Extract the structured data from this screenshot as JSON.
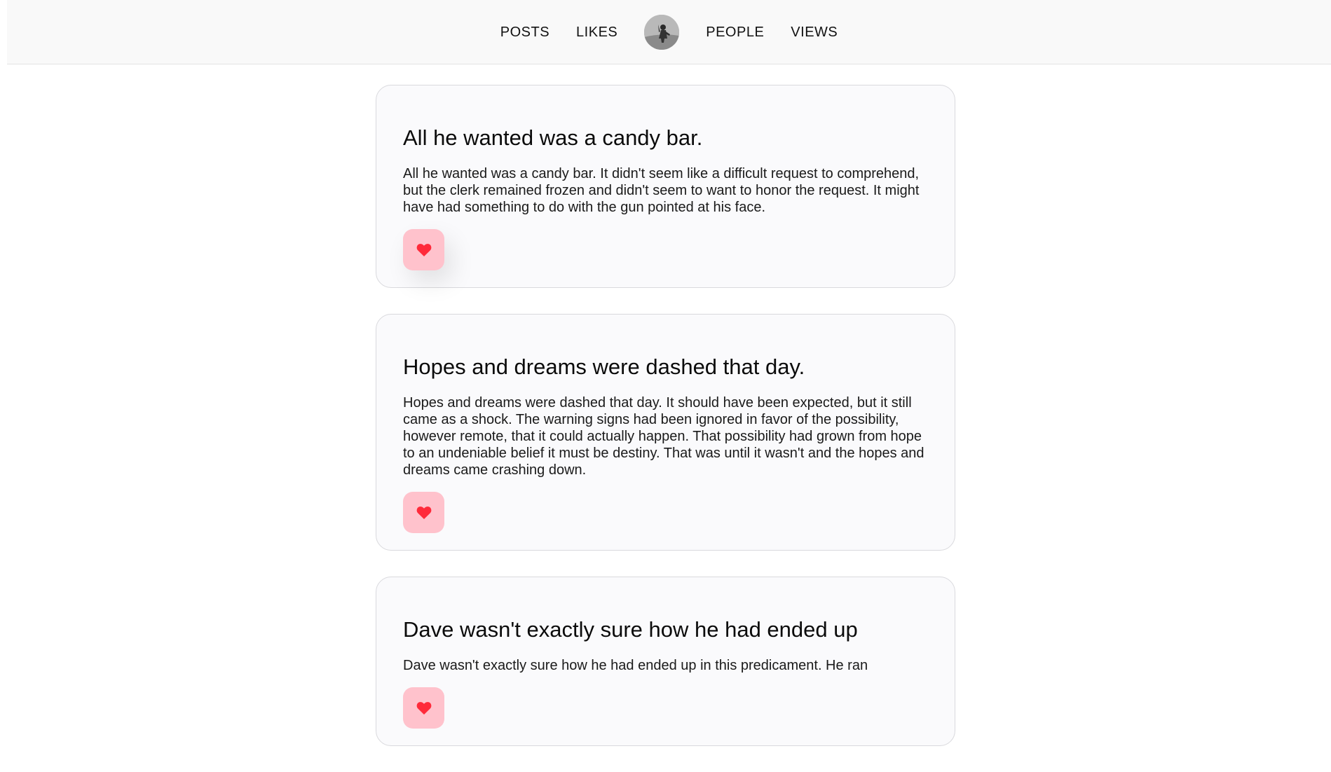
{
  "nav": {
    "items": [
      "POSTS",
      "LIKES",
      "PEOPLE",
      "VIEWS"
    ],
    "avatar_icon": "profile-avatar"
  },
  "colors": {
    "like_bg": "#ffc2cc",
    "heart": "#ff2a3a",
    "card_bg": "#fafafc",
    "topbar_bg": "#f9f9f9"
  },
  "posts": [
    {
      "title": "All he wanted was a candy bar.",
      "body": "All he wanted was a candy bar. It didn't seem like a difficult request to comprehend, but the clerk remained frozen and didn't seem to want to honor the request. It might have had something to do with the gun pointed at his face.",
      "like_icon": "heart-icon"
    },
    {
      "title": "Hopes and dreams were dashed that day.",
      "body": "Hopes and dreams were dashed that day. It should have been expected, but it still came as a shock. The warning signs had been ignored in favor of the possibility, however remote, that it could actually happen. That possibility had grown from hope to an undeniable belief it must be destiny. That was until it wasn't and the hopes and dreams came crashing down.",
      "like_icon": "heart-icon"
    },
    {
      "title": "Dave wasn't exactly sure how he had ended up",
      "body": "Dave wasn't exactly sure how he had ended up in this predicament. He ran",
      "like_icon": "heart-icon"
    }
  ]
}
